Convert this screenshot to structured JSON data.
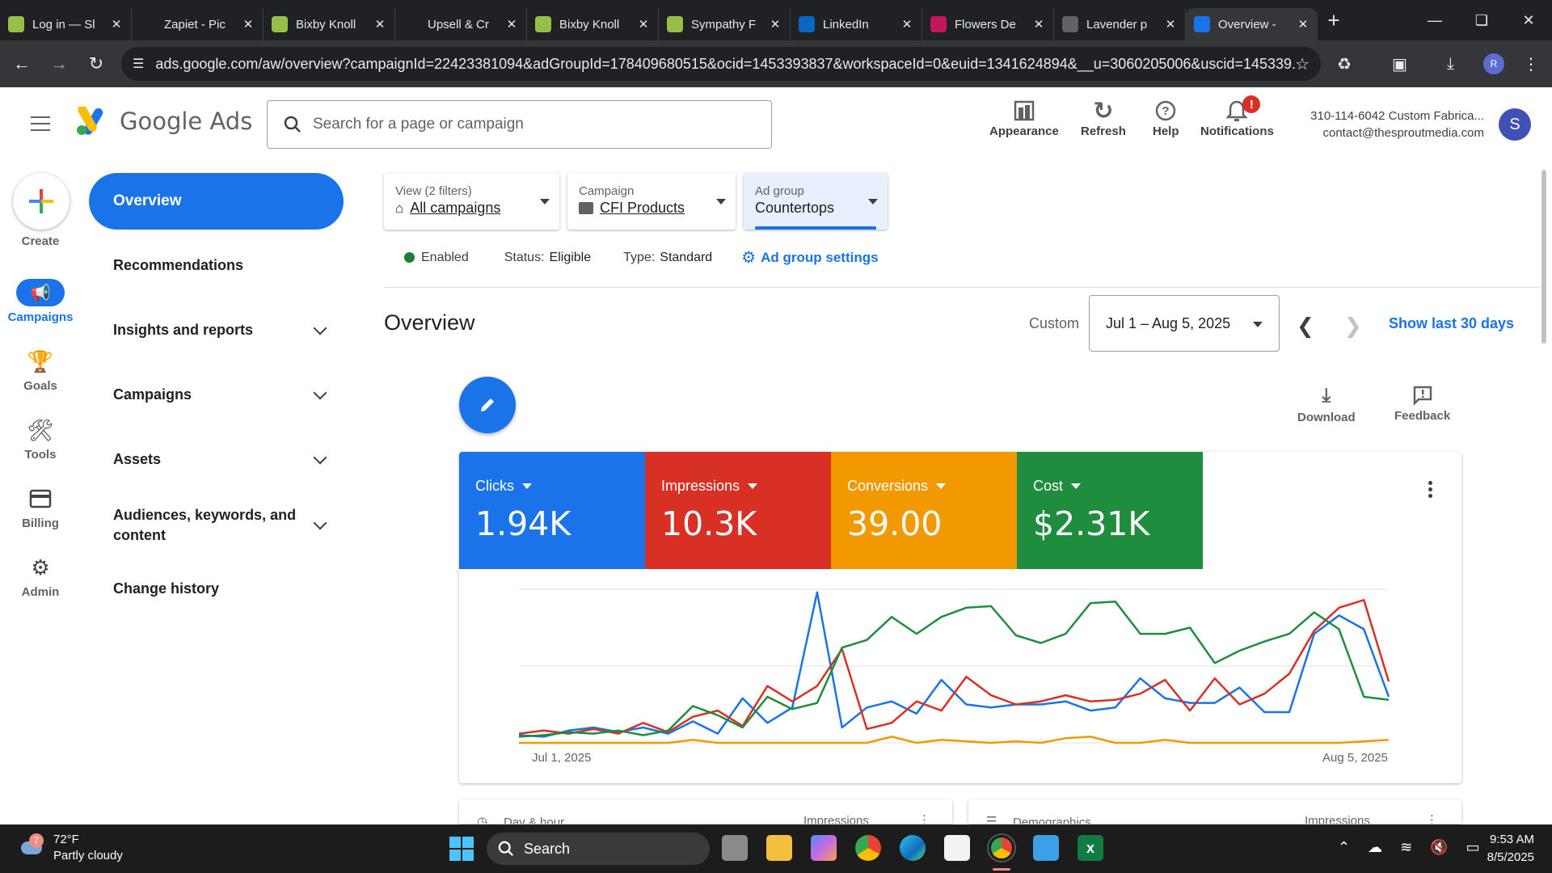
{
  "browser": {
    "tabs": [
      {
        "title": "Log in — Sl",
        "favicon": "shopify-icon",
        "color": "#95bf47",
        "active": false
      },
      {
        "title": "Zapiet - Pic",
        "favicon": "zapiet-icon",
        "color": "#202124",
        "active": false
      },
      {
        "title": "Bixby Knoll",
        "favicon": "shopify-icon",
        "color": "#95bf47",
        "active": false
      },
      {
        "title": "Upsell & Cr",
        "favicon": "upsell-icon",
        "color": "#202124",
        "active": false
      },
      {
        "title": "Bixby Knoll",
        "favicon": "shopify-icon",
        "color": "#95bf47",
        "active": false
      },
      {
        "title": "Sympathy F",
        "favicon": "shopify-icon",
        "color": "#95bf47",
        "active": false
      },
      {
        "title": "LinkedIn",
        "favicon": "linkedin-icon",
        "color": "#0a66c2",
        "active": false
      },
      {
        "title": "Flowers De",
        "favicon": "flower-icon",
        "color": "#c2185b",
        "active": false
      },
      {
        "title": "Lavender p",
        "favicon": "globe-icon",
        "color": "#5f6368",
        "active": false
      },
      {
        "title": "Overview -",
        "favicon": "google-ads-icon",
        "color": "#1a73e8",
        "active": true
      }
    ],
    "url": "ads.google.com/aw/overview?campaignId=22423381094&adGroupId=178409680515&ocid=1453393837&workspaceId=0&euid=1341624894&__u=3060205006&uscid=145339...",
    "profile_initial": "R"
  },
  "header": {
    "brand": "Google Ads",
    "search_placeholder": "Search for a page or campaign",
    "buttons": [
      {
        "label": "Appearance",
        "icon": "appearance-icon"
      },
      {
        "label": "Refresh",
        "icon": "refresh-icon"
      },
      {
        "label": "Help",
        "icon": "help-icon"
      },
      {
        "label": "Notifications",
        "icon": "bell-icon",
        "badge": "!"
      }
    ],
    "account_line1": "310-114-6042 Custom Fabrica...",
    "account_line2": "contact@thesproutmedia.com",
    "avatar_initial": "S"
  },
  "rail": {
    "items": [
      {
        "label": "Create",
        "icon": "plus-icon"
      },
      {
        "label": "Campaigns",
        "icon": "megaphone-icon",
        "active": true
      },
      {
        "label": "Goals",
        "icon": "trophy-icon"
      },
      {
        "label": "Tools",
        "icon": "tools-icon"
      },
      {
        "label": "Billing",
        "icon": "credit-card-icon"
      },
      {
        "label": "Admin",
        "icon": "gear-icon"
      }
    ]
  },
  "sidenav": {
    "active": "Overview",
    "items": [
      {
        "label": "Recommendations",
        "expandable": false
      },
      {
        "label": "Insights and reports",
        "expandable": true
      },
      {
        "label": "Campaigns",
        "expandable": true
      },
      {
        "label": "Assets",
        "expandable": true
      },
      {
        "label": "Audiences, keywords, and content",
        "expandable": true
      },
      {
        "label": "Change history",
        "expandable": false
      }
    ]
  },
  "filters": {
    "view_caption": "View (2 filters)",
    "view_value": "All campaigns",
    "campaign_caption": "Campaign",
    "campaign_value": "CFI Products",
    "adgroup_caption": "Ad group",
    "adgroup_value": "Countertops"
  },
  "status": {
    "enabled": "Enabled",
    "status_label": "Status:",
    "status_value": "Eligible",
    "type_label": "Type:",
    "type_value": "Standard",
    "settings_link": "Ad group settings"
  },
  "overview": {
    "title": "Overview",
    "range_label": "Custom",
    "date_range": "Jul 1 – Aug 5, 2025",
    "show_last": "Show last 30 days",
    "download": "Download",
    "feedback": "Feedback"
  },
  "metrics": [
    {
      "label": "Clicks",
      "value": "1.94K",
      "color": "#1a73e8"
    },
    {
      "label": "Impressions",
      "value": "10.3K",
      "color": "#d93025"
    },
    {
      "label": "Conversions",
      "value": "39.00",
      "color": "#f29900"
    },
    {
      "label": "Cost",
      "value": "$2.31K",
      "color": "#1e8e3e"
    }
  ],
  "chart_data": {
    "type": "line",
    "x_start": "Jul 1, 2025",
    "x_end": "Aug 5, 2025",
    "grid": true,
    "series_colors": [
      "#1a73e8",
      "#d93025",
      "#f29900",
      "#1e8e3e"
    ],
    "series": [
      {
        "name": "Clicks",
        "values": [
          5,
          4,
          8,
          10,
          7,
          10,
          6,
          14,
          6,
          29,
          13,
          23,
          98,
          10,
          23,
          27,
          19,
          41,
          25,
          23,
          25,
          25,
          27,
          21,
          23,
          42,
          29,
          26,
          26,
          36,
          20,
          20,
          71,
          83,
          74,
          30
        ]
      },
      {
        "name": "Impressions",
        "values": [
          6,
          8,
          6,
          9,
          6,
          13,
          7,
          17,
          21,
          11,
          37,
          27,
          37,
          61,
          9,
          13,
          27,
          21,
          43,
          31,
          25,
          27,
          31,
          27,
          28,
          32,
          41,
          21,
          42,
          25,
          32,
          45,
          73,
          88,
          93,
          40
        ]
      },
      {
        "name": "Conversions",
        "values": [
          0,
          0,
          0,
          0,
          0,
          0,
          0,
          2,
          0,
          0,
          0,
          0,
          0,
          0,
          0,
          4,
          0,
          2,
          1,
          0,
          1,
          0,
          3,
          4,
          0,
          0,
          2,
          0,
          0,
          0,
          0,
          0,
          0,
          0,
          1,
          2
        ]
      },
      {
        "name": "Cost",
        "values": [
          4,
          5,
          7,
          6,
          8,
          5,
          8,
          24,
          18,
          10,
          30,
          22,
          26,
          62,
          67,
          82,
          71,
          82,
          88,
          89,
          70,
          65,
          71,
          91,
          92,
          71,
          71,
          75,
          52,
          60,
          66,
          71,
          85,
          74,
          30,
          28
        ]
      }
    ]
  },
  "subcards": [
    {
      "title": "Day & hour",
      "metric": "Impressions"
    },
    {
      "title": "Demographics",
      "metric": "Impressions"
    }
  ],
  "taskbar": {
    "temp": "72°F",
    "weather": "Partly cloudy",
    "weather_badge": "7",
    "search_label": "Search",
    "time": "9:53 AM",
    "date": "8/5/2025"
  }
}
